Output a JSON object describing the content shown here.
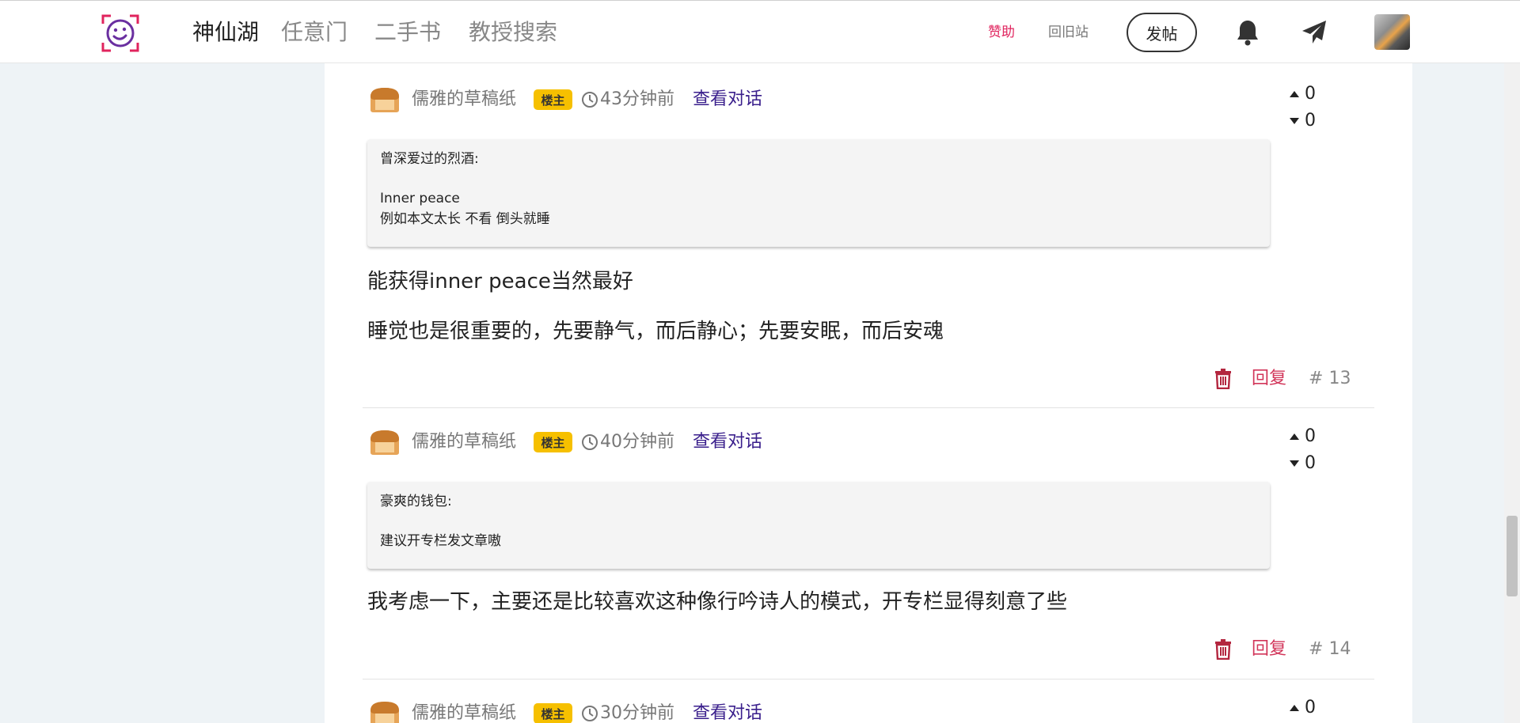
{
  "nav": {
    "items": [
      "神仙湖",
      "任意门",
      "二手书",
      "教授搜索"
    ],
    "sponsor": "赞助",
    "old_site": "回旧站",
    "post_button": "发帖"
  },
  "colors": {
    "accent_red": "#e0245e",
    "badge_yellow": "#f6c000",
    "link_purple": "#3a1f8c",
    "reply_red": "#d2365a"
  },
  "comments": [
    {
      "author": "儒雅的草稿纸",
      "badge": "楼主",
      "time": "43分钟前",
      "view_conversation": "查看对话",
      "quote_author": "曾深爱过的烈酒:",
      "quote_lines": [
        "Inner peace",
        "例如本文太长 不看 倒头就睡"
      ],
      "body": [
        "能获得inner peace当然最好",
        "睡觉也是很重要的，先要静气，而后静心；先要安眠，而后安魂"
      ],
      "upvotes": "0",
      "downvotes": "0",
      "reply_label": "回复",
      "floor": "# 13"
    },
    {
      "author": "儒雅的草稿纸",
      "badge": "楼主",
      "time": "40分钟前",
      "view_conversation": "查看对话",
      "quote_author": "豪爽的钱包:",
      "quote_lines": [
        "建议开专栏发文章嗷"
      ],
      "body": [
        "我考虑一下，主要还是比较喜欢这种像行吟诗人的模式，开专栏显得刻意了些"
      ],
      "upvotes": "0",
      "downvotes": "0",
      "reply_label": "回复",
      "floor": "# 14"
    },
    {
      "author": "儒雅的草稿纸",
      "badge": "楼主",
      "time": "30分钟前",
      "view_conversation": "查看对话",
      "upvotes": "0"
    }
  ]
}
